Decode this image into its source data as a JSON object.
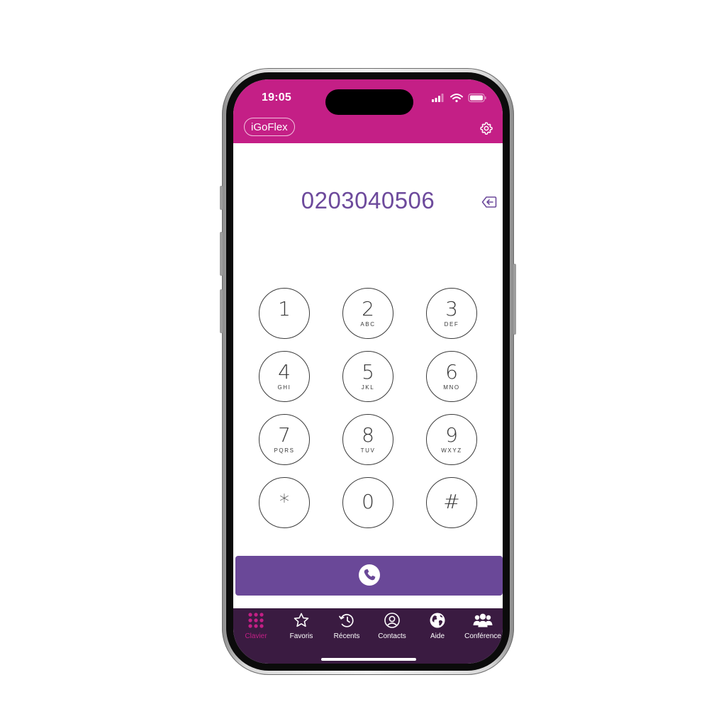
{
  "status_bar": {
    "time": "19:05"
  },
  "header": {
    "brand": "iGoFlex",
    "background_color": "#c41f86"
  },
  "dialer": {
    "number": "0203040506",
    "number_color": "#6d4a9c",
    "keys": [
      {
        "digit": "1",
        "letters": ""
      },
      {
        "digit": "2",
        "letters": "ABC"
      },
      {
        "digit": "3",
        "letters": "DEF"
      },
      {
        "digit": "4",
        "letters": "GHI"
      },
      {
        "digit": "5",
        "letters": "JKL"
      },
      {
        "digit": "6",
        "letters": "MNO"
      },
      {
        "digit": "7",
        "letters": "PQRS"
      },
      {
        "digit": "8",
        "letters": "TUV"
      },
      {
        "digit": "9",
        "letters": "WXYZ"
      },
      {
        "digit": "*",
        "letters": ""
      },
      {
        "digit": "0",
        "letters": ""
      },
      {
        "digit": "#",
        "letters": ""
      }
    ],
    "call_button_color": "#6a4898"
  },
  "tabbar": {
    "background_color": "#3a1b41",
    "active_color": "#c41f86",
    "tabs": [
      {
        "label": "Clavier",
        "icon": "keypad-grid-icon",
        "active": true
      },
      {
        "label": "Favoris",
        "icon": "star-icon",
        "active": false
      },
      {
        "label": "Récents",
        "icon": "history-clock-icon",
        "active": false
      },
      {
        "label": "Contacts",
        "icon": "user-circle-icon",
        "active": false
      },
      {
        "label": "Aide",
        "icon": "globe-icon",
        "active": false
      },
      {
        "label": "Conférence",
        "icon": "group-users-icon",
        "active": false
      }
    ]
  }
}
